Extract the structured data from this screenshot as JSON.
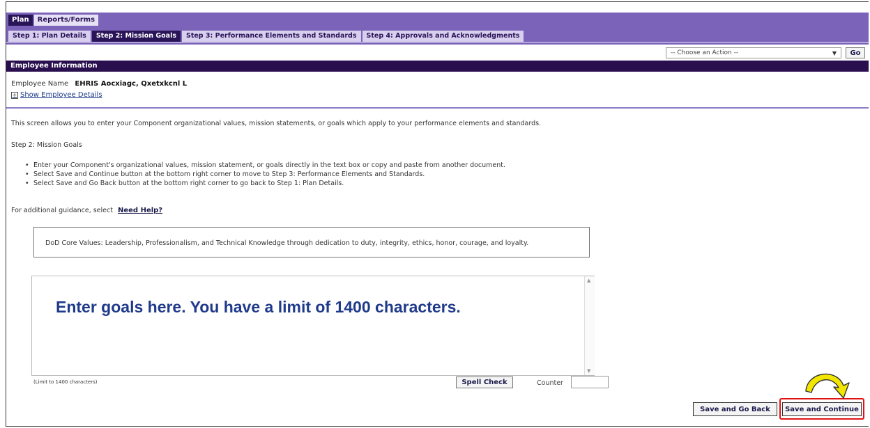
{
  "tabs": {
    "plan": "Plan",
    "reports": "Reports/Forms"
  },
  "steps": [
    {
      "label": "Step 1: Plan Details",
      "active": false
    },
    {
      "label": "Step 2: Mission Goals",
      "active": true
    },
    {
      "label": "Step 3: Performance Elements and Standards",
      "active": false
    },
    {
      "label": "Step 4: Approvals and Acknowledgments",
      "active": false
    }
  ],
  "action": {
    "placeholder": "-- Choose an Action --",
    "go_label": "Go"
  },
  "employee": {
    "header": "Employee Information",
    "name_label": "Employee Name",
    "name_value": "EHRIS Aocxiagc, Qxetxkcnl L",
    "show_details": "Show Employee Details"
  },
  "content": {
    "intro": "This screen allows you to enter your Component organizational values, mission statements, or goals which apply to your performance elements and standards.",
    "step_title": "Step 2: Mission Goals",
    "bullets": [
      "Enter your Component's organizational values, mission statement, or goals directly in the text box or copy and paste from another document.",
      "Select Save and Continue button at the bottom right corner to move to Step 3: Performance Elements and Standards.",
      "Select Save and Go Back button at the bottom right corner to go back to Step 1: Plan Details."
    ],
    "guidance_text": "For additional guidance, select",
    "help_link": "Need Help?",
    "core_values": "DoD Core Values: Leadership, Professionalism, and Technical Knowledge through dedication to duty, integrity, ethics, honor, courage, and loyalty.",
    "goals_placeholder": "Enter goals here.  You have a limit of 1400 characters.",
    "limit_note": "(Limit to 1400 characters)",
    "spell_check": "Spell Check",
    "counter_label": "Counter",
    "counter_value": ""
  },
  "buttons": {
    "save_back": "Save and Go Back",
    "save_continue": "Save and Continue"
  },
  "colors": {
    "header_purple": "#7b63b9",
    "dark_purple": "#2a0f4f",
    "highlight_red": "#e21212",
    "arrow_yellow": "#f2e600"
  }
}
